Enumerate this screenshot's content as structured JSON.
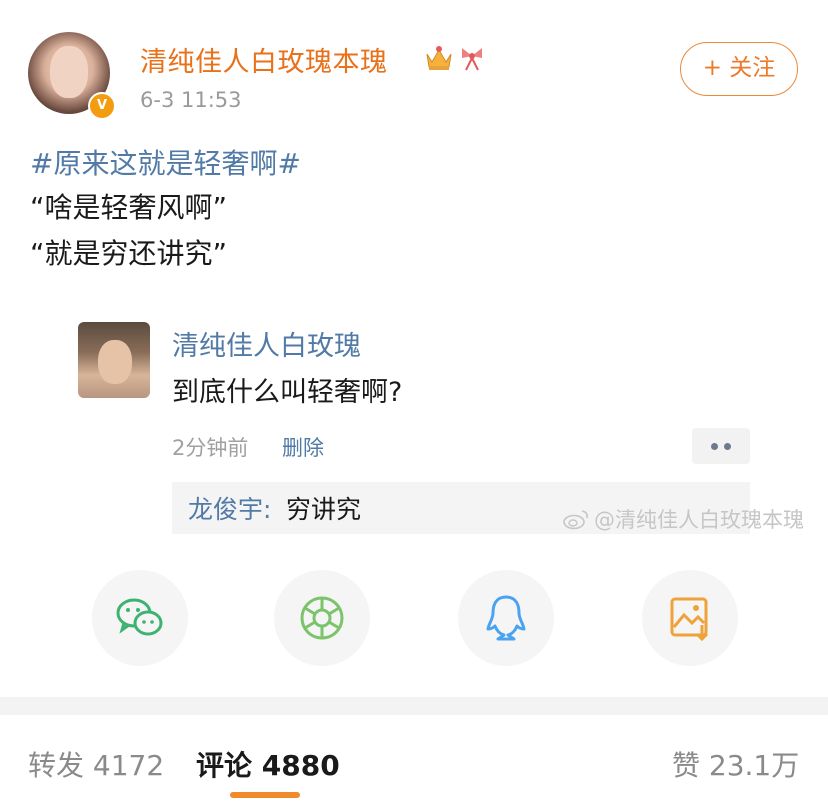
{
  "post": {
    "username": "清纯佳人白玫瑰本瑰",
    "time": "6-3 11:53",
    "follow_label": "+ 关注",
    "verified_badge": "V",
    "hashtag": "#原来这就是轻奢啊#",
    "lines": [
      "“啥是轻奢风啊”",
      "“就是穷还讲究”"
    ]
  },
  "comment": {
    "username": "清纯佳人白玫瑰",
    "text": "到底什么叫轻奢啊?",
    "time": "2分钟前",
    "delete_label": "删除",
    "reply": {
      "name": "龙俊宇:",
      "text": "穷讲究"
    }
  },
  "watermark": "@清纯佳人白玫瑰本瑰",
  "share": {
    "icons": [
      "wechat-icon",
      "moments-icon",
      "qq-icon",
      "save-image-icon"
    ],
    "colors": {
      "wechat": "#3cb371",
      "moments": "#7cc36b",
      "qq": "#4aa3f0",
      "save": "#f0a23a"
    }
  },
  "tabs": {
    "repost": "转发 4172",
    "comment": "评论 4880",
    "like": "赞 23.1万"
  },
  "colors": {
    "username": "#e8711a",
    "link": "#517aa7",
    "accent": "#f08a2c"
  }
}
